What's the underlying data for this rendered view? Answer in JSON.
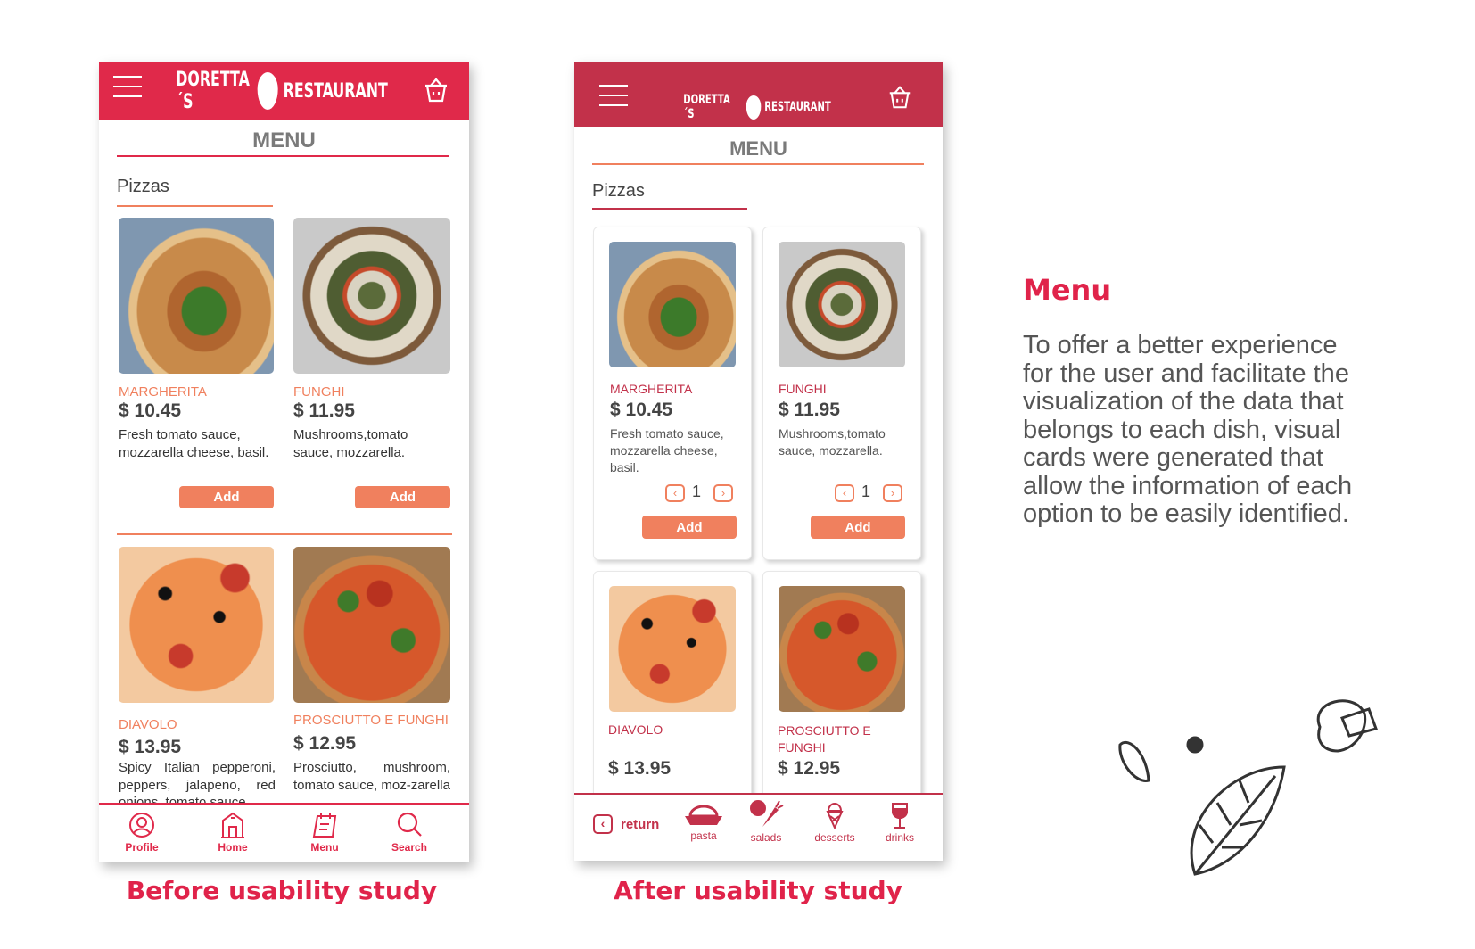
{
  "colors": {
    "before_header": "#e0294a",
    "after_header": "#c2314a",
    "accent_orange": "#f0805e",
    "caption_red": "#e0234a"
  },
  "brand": {
    "left": "DORETTA´S",
    "right": "RESTAURANT"
  },
  "before": {
    "menu_title": "MENU",
    "section": "Pizzas",
    "items": [
      {
        "name": "MARGHERITA",
        "price": "$ 10.45",
        "desc": "Fresh tomato sauce, mozzarella cheese, basil.",
        "add": "Add"
      },
      {
        "name": "FUNGHI",
        "price": "$ 11.95",
        "desc": "Mushrooms,tomato sauce, mozzarella.",
        "add": "Add"
      },
      {
        "name": "DIAVOLO",
        "price": "$ 13.95",
        "desc": "Spicy Italian pepperoni, peppers, jalapeno, red onions, tomato sauce"
      },
      {
        "name": "PROSCIUTTO E FUNGHI",
        "price": "$ 12.95",
        "desc": "Prosciutto, mushroom, tomato sauce, moz-zarella"
      }
    ],
    "nav": [
      {
        "label": "Profile",
        "icon": "user-icon"
      },
      {
        "label": "Home",
        "icon": "home-icon"
      },
      {
        "label": "Menu",
        "icon": "menu-calendar-icon"
      },
      {
        "label": "Search",
        "icon": "search-icon"
      }
    ],
    "caption": "Before usability study"
  },
  "after": {
    "brand": {
      "left": "DORETTA ´S",
      "right": "RESTAURANT"
    },
    "menu_title": "MENU",
    "section": "Pizzas",
    "items": [
      {
        "name": "MARGHERITA",
        "price": "$ 10.45",
        "desc": "Fresh tomato sauce, mozzarella cheese, basil.",
        "qty": "1",
        "add": "Add"
      },
      {
        "name": "FUNGHI",
        "price": "$ 11.95",
        "desc": "Mushrooms,tomato sauce, mozzarella.",
        "qty": "1",
        "add": "Add"
      },
      {
        "name": "DIAVOLO",
        "price": "$ 13.95"
      },
      {
        "name": "PROSCIUTTO E FUNGHI",
        "price": "$ 12.95"
      }
    ],
    "return": "return",
    "nav": [
      {
        "label": "pasta",
        "icon": "pasta-icon"
      },
      {
        "label": "salads",
        "icon": "salad-icon"
      },
      {
        "label": "desserts",
        "icon": "ice-cream-icon"
      },
      {
        "label": "drinks",
        "icon": "wine-glass-icon"
      }
    ],
    "caption": "After usability study"
  },
  "description": {
    "title": "Menu",
    "lines": [
      "To offer a better experience",
      "for the user and facilitate the",
      "visualization of the data that",
      "belongs to each dish, visual",
      "cards were generated that",
      "allow the information of each",
      "option to be easily identified."
    ]
  }
}
